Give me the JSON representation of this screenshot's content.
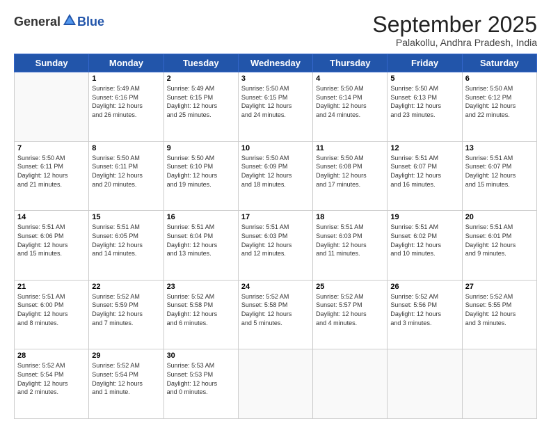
{
  "header": {
    "logo_general": "General",
    "logo_blue": "Blue",
    "month_title": "September 2025",
    "subtitle": "Palakollu, Andhra Pradesh, India"
  },
  "days_of_week": [
    "Sunday",
    "Monday",
    "Tuesday",
    "Wednesday",
    "Thursday",
    "Friday",
    "Saturday"
  ],
  "weeks": [
    [
      {
        "day": "",
        "info": ""
      },
      {
        "day": "1",
        "info": "Sunrise: 5:49 AM\nSunset: 6:16 PM\nDaylight: 12 hours\nand 26 minutes."
      },
      {
        "day": "2",
        "info": "Sunrise: 5:49 AM\nSunset: 6:15 PM\nDaylight: 12 hours\nand 25 minutes."
      },
      {
        "day": "3",
        "info": "Sunrise: 5:50 AM\nSunset: 6:15 PM\nDaylight: 12 hours\nand 24 minutes."
      },
      {
        "day": "4",
        "info": "Sunrise: 5:50 AM\nSunset: 6:14 PM\nDaylight: 12 hours\nand 24 minutes."
      },
      {
        "day": "5",
        "info": "Sunrise: 5:50 AM\nSunset: 6:13 PM\nDaylight: 12 hours\nand 23 minutes."
      },
      {
        "day": "6",
        "info": "Sunrise: 5:50 AM\nSunset: 6:12 PM\nDaylight: 12 hours\nand 22 minutes."
      }
    ],
    [
      {
        "day": "7",
        "info": "Sunrise: 5:50 AM\nSunset: 6:11 PM\nDaylight: 12 hours\nand 21 minutes."
      },
      {
        "day": "8",
        "info": "Sunrise: 5:50 AM\nSunset: 6:11 PM\nDaylight: 12 hours\nand 20 minutes."
      },
      {
        "day": "9",
        "info": "Sunrise: 5:50 AM\nSunset: 6:10 PM\nDaylight: 12 hours\nand 19 minutes."
      },
      {
        "day": "10",
        "info": "Sunrise: 5:50 AM\nSunset: 6:09 PM\nDaylight: 12 hours\nand 18 minutes."
      },
      {
        "day": "11",
        "info": "Sunrise: 5:50 AM\nSunset: 6:08 PM\nDaylight: 12 hours\nand 17 minutes."
      },
      {
        "day": "12",
        "info": "Sunrise: 5:51 AM\nSunset: 6:07 PM\nDaylight: 12 hours\nand 16 minutes."
      },
      {
        "day": "13",
        "info": "Sunrise: 5:51 AM\nSunset: 6:07 PM\nDaylight: 12 hours\nand 15 minutes."
      }
    ],
    [
      {
        "day": "14",
        "info": "Sunrise: 5:51 AM\nSunset: 6:06 PM\nDaylight: 12 hours\nand 15 minutes."
      },
      {
        "day": "15",
        "info": "Sunrise: 5:51 AM\nSunset: 6:05 PM\nDaylight: 12 hours\nand 14 minutes."
      },
      {
        "day": "16",
        "info": "Sunrise: 5:51 AM\nSunset: 6:04 PM\nDaylight: 12 hours\nand 13 minutes."
      },
      {
        "day": "17",
        "info": "Sunrise: 5:51 AM\nSunset: 6:03 PM\nDaylight: 12 hours\nand 12 minutes."
      },
      {
        "day": "18",
        "info": "Sunrise: 5:51 AM\nSunset: 6:03 PM\nDaylight: 12 hours\nand 11 minutes."
      },
      {
        "day": "19",
        "info": "Sunrise: 5:51 AM\nSunset: 6:02 PM\nDaylight: 12 hours\nand 10 minutes."
      },
      {
        "day": "20",
        "info": "Sunrise: 5:51 AM\nSunset: 6:01 PM\nDaylight: 12 hours\nand 9 minutes."
      }
    ],
    [
      {
        "day": "21",
        "info": "Sunrise: 5:51 AM\nSunset: 6:00 PM\nDaylight: 12 hours\nand 8 minutes."
      },
      {
        "day": "22",
        "info": "Sunrise: 5:52 AM\nSunset: 5:59 PM\nDaylight: 12 hours\nand 7 minutes."
      },
      {
        "day": "23",
        "info": "Sunrise: 5:52 AM\nSunset: 5:58 PM\nDaylight: 12 hours\nand 6 minutes."
      },
      {
        "day": "24",
        "info": "Sunrise: 5:52 AM\nSunset: 5:58 PM\nDaylight: 12 hours\nand 5 minutes."
      },
      {
        "day": "25",
        "info": "Sunrise: 5:52 AM\nSunset: 5:57 PM\nDaylight: 12 hours\nand 4 minutes."
      },
      {
        "day": "26",
        "info": "Sunrise: 5:52 AM\nSunset: 5:56 PM\nDaylight: 12 hours\nand 3 minutes."
      },
      {
        "day": "27",
        "info": "Sunrise: 5:52 AM\nSunset: 5:55 PM\nDaylight: 12 hours\nand 3 minutes."
      }
    ],
    [
      {
        "day": "28",
        "info": "Sunrise: 5:52 AM\nSunset: 5:54 PM\nDaylight: 12 hours\nand 2 minutes."
      },
      {
        "day": "29",
        "info": "Sunrise: 5:52 AM\nSunset: 5:54 PM\nDaylight: 12 hours\nand 1 minute."
      },
      {
        "day": "30",
        "info": "Sunrise: 5:53 AM\nSunset: 5:53 PM\nDaylight: 12 hours\nand 0 minutes."
      },
      {
        "day": "",
        "info": ""
      },
      {
        "day": "",
        "info": ""
      },
      {
        "day": "",
        "info": ""
      },
      {
        "day": "",
        "info": ""
      }
    ]
  ]
}
